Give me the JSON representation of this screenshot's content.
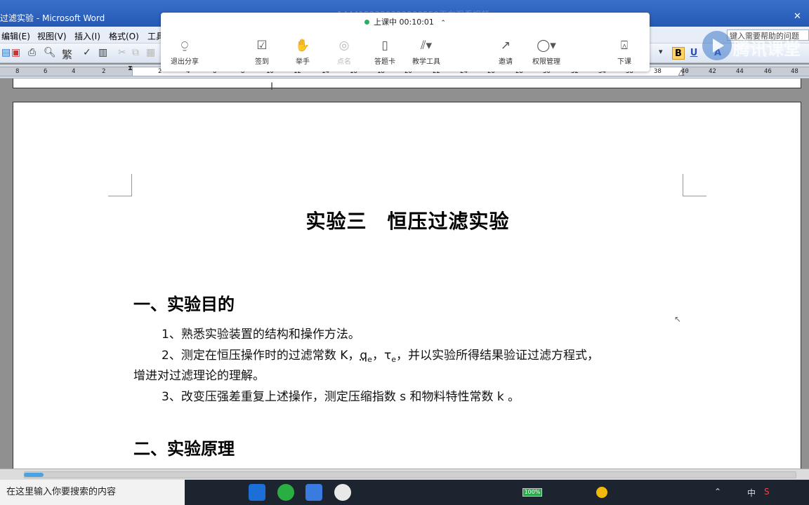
{
  "window": {
    "title": "过滤实验 - Microsoft Word"
  },
  "menu": {
    "items": [
      "编辑(E)",
      "视图(V)",
      "插入(I)",
      "格式(O)",
      "工具"
    ]
  },
  "help_box": {
    "placeholder": "键入需要帮助的问题"
  },
  "ruler": {
    "ticks": [
      "8",
      "6",
      "4",
      "2",
      "2",
      "4",
      "6",
      "8",
      "10",
      "12",
      "14",
      "16",
      "18",
      "20",
      "22",
      "24",
      "26",
      "28",
      "30",
      "32",
      "34",
      "36",
      "38",
      "40",
      "42",
      "44",
      "46",
      "48"
    ]
  },
  "meeting": {
    "id_text": "1444152320322200559正在观看视频",
    "status": "上课中 00:10:01",
    "buttons": [
      {
        "label": "退出分享",
        "icon": "exit-share-icon",
        "enabled": true
      },
      {
        "label": "签到",
        "icon": "checkin-icon",
        "enabled": true
      },
      {
        "label": "举手",
        "icon": "raise-hand-icon",
        "enabled": true
      },
      {
        "label": "点名",
        "icon": "rollcall-icon",
        "enabled": false
      },
      {
        "label": "答题卡",
        "icon": "answer-card-icon",
        "enabled": true
      },
      {
        "label": "教学工具",
        "icon": "teaching-tools-icon",
        "enabled": true
      },
      {
        "label": "邀请",
        "icon": "invite-icon",
        "enabled": true
      },
      {
        "label": "权限管理",
        "icon": "permission-icon",
        "enabled": true
      },
      {
        "label": "下课",
        "icon": "end-class-icon",
        "enabled": true
      }
    ]
  },
  "logo": {
    "text": "腾讯课堂"
  },
  "document": {
    "title": "实验三　恒压过滤实验",
    "section1": "一、实验目的",
    "item1": "1、熟悉实验装置的结构和操作方法。",
    "item2_a": "2、测定在恒压操作时的过滤常数 K，",
    "item2_q": "q",
    "item2_qsub": "e",
    "item2_tau": "，τ",
    "item2_tausub": "e",
    "item2_b": "，并以实验所得结果验证过滤方程式，",
    "item2_cont": "增进对过滤理论的理解。",
    "item3": "3、改变压强差重复上述操作，测定压缩指数 s 和物料特性常数 k 。",
    "section2": "二、实验原理"
  },
  "taskbar": {
    "search_placeholder": "在这里输入你要搜索的内容",
    "battery": "100%",
    "ime": "中"
  },
  "colors": {
    "titlebar": "#2458b5",
    "toolbar": "#dbe4f2",
    "accent_green": "#22b35e"
  }
}
